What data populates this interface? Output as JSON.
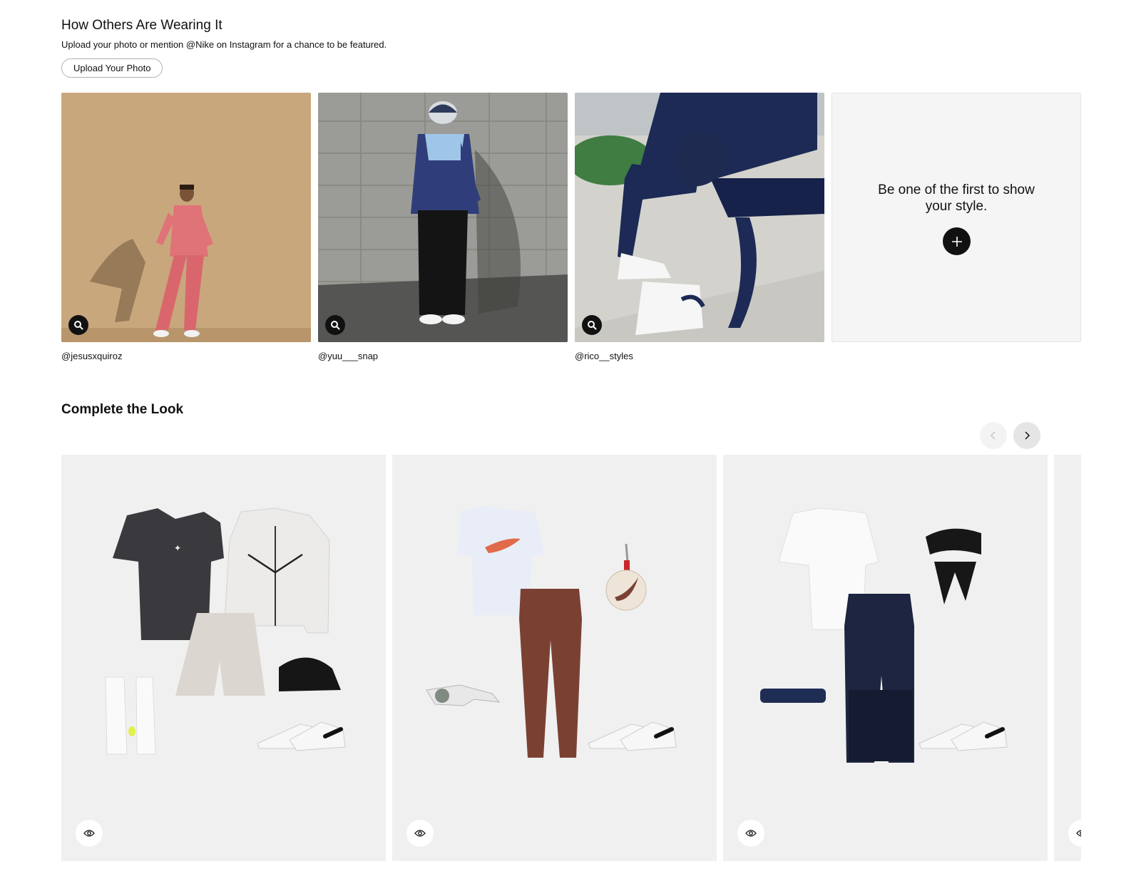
{
  "ugc": {
    "title": "How Others Are Wearing It",
    "subtitle": "Upload your photo or mention @Nike on Instagram for a chance to be featured.",
    "upload_label": "Upload Your Photo",
    "photos": [
      {
        "handle": "@jesusxquiroz",
        "zoom_icon": "search-icon"
      },
      {
        "handle": "@yuu___snap",
        "zoom_icon": "search-icon"
      },
      {
        "handle": "@rico__styles",
        "zoom_icon": "search-icon"
      }
    ],
    "empty_card": {
      "text": "Be one of the first to show your style.",
      "icon": "plus-icon"
    }
  },
  "complete_look": {
    "title": "Complete the Look",
    "prev_icon": "chevron-left-icon",
    "next_icon": "chevron-right-icon",
    "card_icon": "eye-icon"
  },
  "colors": {
    "card_bg": "#f0f0f0",
    "button_dark": "#111111",
    "empty_bg": "#f5f5f5"
  }
}
